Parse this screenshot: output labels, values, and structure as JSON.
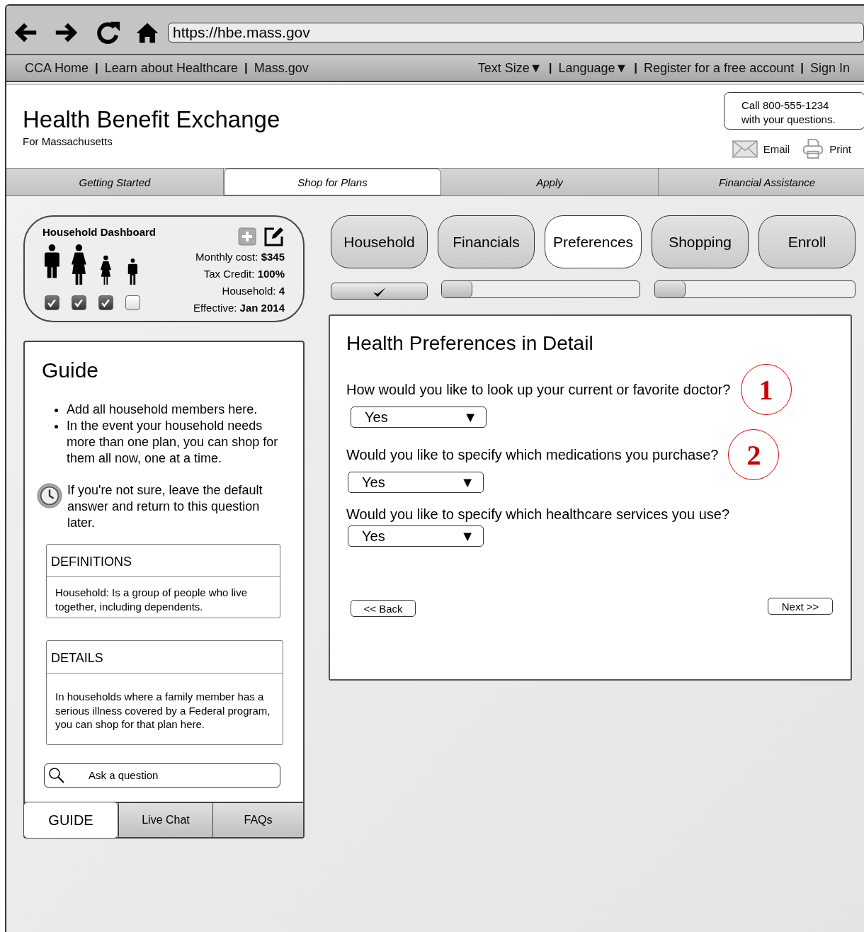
{
  "browser": {
    "url": "https://hbe.mass.gov"
  },
  "top_nav": {
    "left": [
      {
        "kind": "link",
        "text": "CCA Home"
      },
      {
        "kind": "sep",
        "text": "|"
      },
      {
        "kind": "link",
        "text": "Learn about Healthcare"
      },
      {
        "kind": "sep",
        "text": "|"
      },
      {
        "kind": "link",
        "text": "Mass.gov"
      }
    ],
    "right": [
      {
        "kind": "link",
        "text": "Text Size▼"
      },
      {
        "kind": "sep",
        "text": "|"
      },
      {
        "kind": "link",
        "text": "Language▼"
      },
      {
        "kind": "sep",
        "text": "|"
      },
      {
        "kind": "link",
        "text": "Register for a free account"
      },
      {
        "kind": "sep",
        "text": "|"
      },
      {
        "kind": "link",
        "text": "Sign In"
      }
    ]
  },
  "header": {
    "title": "Health Benefit Exchange",
    "subtitle": "For Massachusetts",
    "call_box": [
      "Call 800-555-1234",
      "with your questions."
    ],
    "actions": [
      {
        "kind": "email",
        "label": "Email"
      },
      {
        "kind": "print",
        "label": "Print"
      }
    ]
  },
  "tabs": [
    {
      "label": "Getting Started",
      "selected": false
    },
    {
      "label": "Shop for Plans",
      "selected": true
    },
    {
      "label": "Apply",
      "selected": false
    },
    {
      "label": "Financial Assistance",
      "selected": false
    }
  ],
  "dashboard": {
    "title": "Household Dashboard",
    "members": [
      {
        "kind": "man",
        "checked": true
      },
      {
        "kind": "woman",
        "checked": true
      },
      {
        "kind": "girl",
        "checked": true
      },
      {
        "kind": "boy",
        "checked": false
      }
    ],
    "stats": [
      "Monthly cost: **$345**",
      "Tax  Credit: **100%**",
      "Household: **4**",
      "Effective: **Jan 2014**"
    ]
  },
  "guide": {
    "title": "Guide",
    "bullets": [
      "Add all household members here.",
      "In the event your household needs more than one plan, you can shop for them all now, one at a time."
    ],
    "tip": "If you're not sure, leave the default answer and return to this question later.",
    "boxes": [
      {
        "heading": "DEFINITIONS",
        "text": "Household: Is a group of people who live together, including dependents."
      },
      {
        "heading": "DETAILS",
        "text": "In households where a family member has a serious illness covered by a Federal program, you can shop for that plan here."
      }
    ],
    "search": {
      "placeholder": "Ask a question"
    },
    "tabs": [
      {
        "label": "GUIDE",
        "selected": true
      },
      {
        "label": "Live Chat",
        "selected": false
      },
      {
        "label": "FAQs",
        "selected": false
      }
    ]
  },
  "steps": [
    {
      "label": "Household",
      "selected": false
    },
    {
      "label": "Financials",
      "selected": false
    },
    {
      "label": "Preferences",
      "selected": true
    },
    {
      "label": "Shopping",
      "selected": false
    },
    {
      "label": "Enroll",
      "selected": false
    }
  ],
  "progress": [
    {
      "kind": "complete"
    },
    {
      "kind": "bar",
      "level": 0.15
    },
    {
      "kind": "bar",
      "level": 0.15
    }
  ],
  "detail": {
    "title": "Health Preferences in Detail",
    "questions": [
      {
        "text": "How would you like to look up your current or favorite doctor?",
        "value": "Yes",
        "arrow": "▼",
        "marker": "1"
      },
      {
        "text": "Would you like to specify which medications you purchase?",
        "value": "Yes",
        "arrow": "▼",
        "marker": "2"
      },
      {
        "text": "Would you like to specify which healthcare services you use?",
        "value": "Yes",
        "arrow": "▼"
      }
    ],
    "back": "<< Back",
    "next": "Next >>"
  }
}
